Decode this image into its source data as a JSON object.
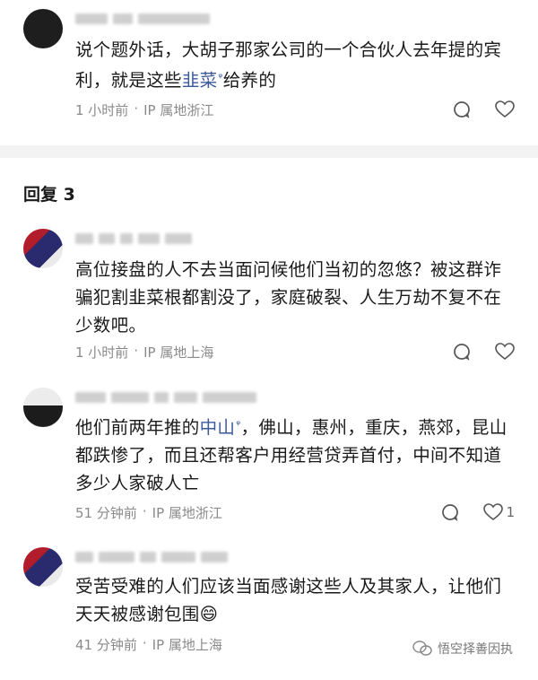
{
  "comments": [
    {
      "text_parts": [
        "说个题外话，大胡子那家公司的一个合伙人去年提的宾利，就是这些",
        "韭菜",
        "给养的"
      ],
      "time": "1 小时前",
      "location": "IP 属地浙江"
    }
  ],
  "reply_header": "回复 3",
  "replies": [
    {
      "text": "高位接盘的人不去当面问候他们当初的忽悠？被这群诈骗犯割韭菜根都割没了，家庭破裂、人生万劫不复不在少数吧。",
      "time": "1 小时前",
      "location": "IP 属地上海"
    },
    {
      "text_parts": [
        "他们前两年推的",
        "中山",
        "，佛山，惠州，重庆，燕郊，昆山都跌惨了，而且还帮客户用经营贷弄首付，中间不知道多少人家破人亡"
      ],
      "time": "51 分钟前",
      "location": "IP 属地浙江",
      "like_count": "1"
    },
    {
      "text": "受苦受难的人们应该当面感谢这些人及其家人，让他们天天被感谢包围",
      "emoji": "😄",
      "time": "41 分钟前",
      "location": "IP 属地上海"
    }
  ],
  "watermark": "悟空择善因执",
  "icons": {
    "reply": "reply-bubble-icon",
    "like": "heart-icon",
    "search_tag": "search-tag-icon",
    "wechat": "wechat-icon"
  }
}
